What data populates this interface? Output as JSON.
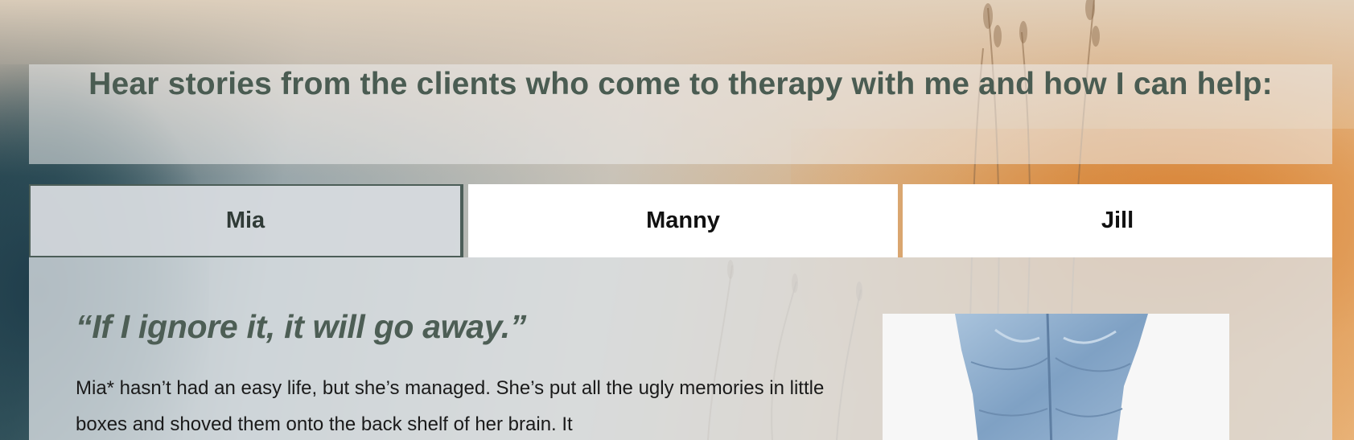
{
  "section": {
    "heading": "Hear stories from the clients who come to therapy with me and how I can help:"
  },
  "tabs": [
    {
      "label": "Mia",
      "active": true
    },
    {
      "label": "Manny",
      "active": false
    },
    {
      "label": "Jill",
      "active": false
    }
  ],
  "story": {
    "quote": "“If I ignore it, it will go away.”",
    "body": "Mia* hasn’t had an easy life, but she’s managed. She’s put all the ugly memories in little boxes and shoved them onto the back shelf of her brain. It"
  },
  "colors": {
    "heading": "#4a5c52",
    "active_tab_bg": "#d6dade",
    "tab_bg": "#ffffff",
    "quote": "#4d5e55"
  },
  "icons": {
    "photo": "jeans-photo"
  }
}
